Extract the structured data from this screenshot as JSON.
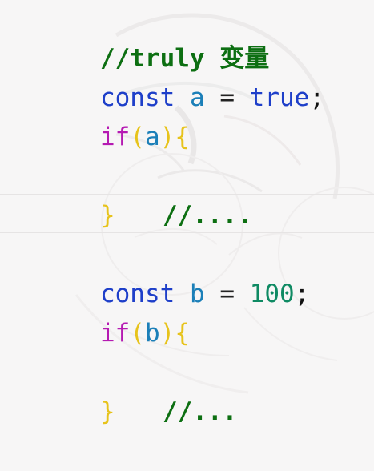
{
  "block1": {
    "comment": "//truly 变量",
    "decl": {
      "keyword": "const",
      "identifier": "a",
      "operator": "=",
      "value": "true",
      "semicolon": ";"
    },
    "if_line": {
      "keyword": "if",
      "open_paren": "(",
      "condition": "a",
      "close_paren": ")",
      "open_brace": "{"
    },
    "body_comment": "//....",
    "close_brace": "}"
  },
  "block2": {
    "decl": {
      "keyword": "const",
      "identifier": "b",
      "operator": "=",
      "value": "100",
      "semicolon": ";"
    },
    "if_line": {
      "keyword": "if",
      "open_paren": "(",
      "condition": "b",
      "close_paren": ")",
      "open_brace": "{"
    },
    "body_comment": "//...",
    "close_brace": "}"
  }
}
